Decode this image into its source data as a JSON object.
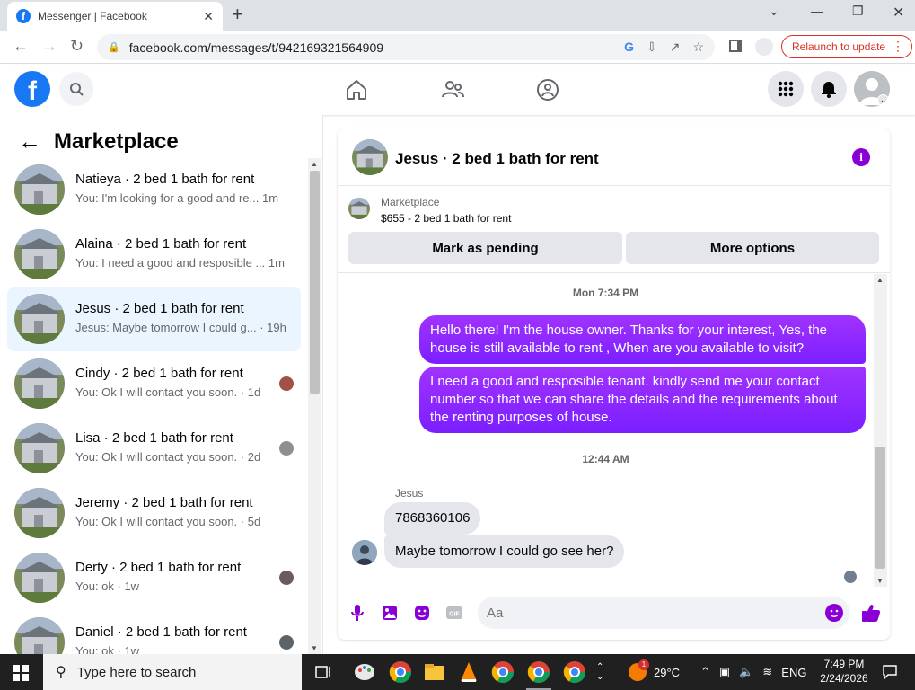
{
  "browser": {
    "tab_title": "Messenger | Facebook",
    "url": "facebook.com/messages/t/942169321564909",
    "relaunch_label": "Relaunch to update"
  },
  "marketplace": {
    "title": "Marketplace",
    "conversations": [
      {
        "name": "Natieya · 2 bed 1 bath for rent",
        "preview": "You: I'm looking for a good and re... 1m"
      },
      {
        "name": "Alaina · 2 bed 1 bath for rent",
        "preview": "You: I need a good and resposible ... 1m"
      },
      {
        "name": "Jesus · 2 bed 1 bath for rent",
        "preview": "Jesus: Maybe tomorrow I could g... · 19h"
      },
      {
        "name": "Cindy · 2 bed 1 bath for rent",
        "preview": "You: Ok I will contact you soon. · 1d"
      },
      {
        "name": "Lisa · 2 bed 1 bath for rent",
        "preview": "You: Ok I will contact you soon. · 2d"
      },
      {
        "name": "Jeremy · 2 bed 1 bath for rent",
        "preview": "You: Ok I will contact you soon. · 5d"
      },
      {
        "name": "Derty · 2 bed 1 bath for rent",
        "preview": "You: ok · 1w"
      },
      {
        "name": "Daniel · 2 bed 1 bath for rent",
        "preview": "You: ok · 1w"
      }
    ]
  },
  "chat": {
    "title": "Jesus · 2 bed 1 bath for rent",
    "listing_label": "Marketplace",
    "listing_price": "$655 - 2 bed 1 bath for rent",
    "mark_pending_label": "Mark as pending",
    "more_options_label": "More options",
    "timestamp1": "Mon 7:34 PM",
    "out_msg1": "Hello there! I'm the house owner. Thanks for your interest, Yes, the house is still available to rent , When are you available to visit?",
    "out_msg2": "I need a good and resposible tenant.  kindly send me your contact number so that we can share the details and the requirements about the renting purposes of house.",
    "timestamp2": "12:44 AM",
    "sender_name": "Jesus",
    "in_msg1": "7868360106",
    "in_msg2": "Maybe tomorrow I could go see her?",
    "input_placeholder": "Aa",
    "accent_color": "#8a00d4"
  },
  "taskbar": {
    "search_placeholder": "Type here to search",
    "weather": "29°C",
    "weather_badge": "1",
    "language": "ENG",
    "time": "7:49 PM",
    "date": "2/24/2026"
  }
}
